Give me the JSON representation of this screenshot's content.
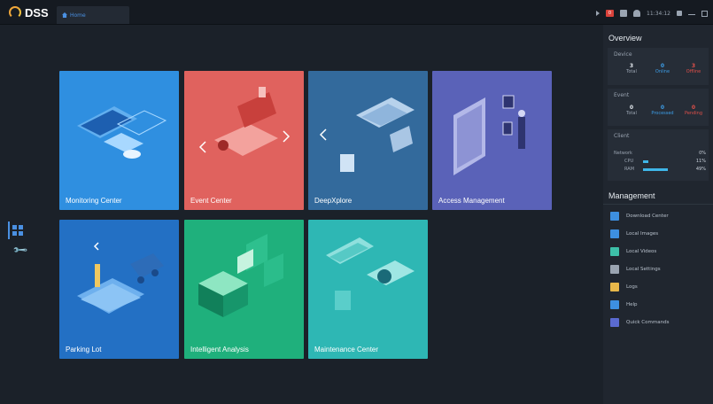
{
  "app": {
    "logo_text": "DSS",
    "home_tab": "Home"
  },
  "tray": {
    "alarm_count": "0",
    "time": "11:34:12"
  },
  "tiles": [
    {
      "label": "Monitoring Center",
      "color": "#2f8fe0"
    },
    {
      "label": "Event Center",
      "color": "#e0625e"
    },
    {
      "label": "DeepXplore",
      "color": "#336a9c"
    },
    {
      "label": "Access Management",
      "color": "#5a62b8"
    },
    {
      "label": "Parking Lot",
      "color": "#2370c4"
    },
    {
      "label": "Intelligent Analysis",
      "color": "#1fb07c"
    },
    {
      "label": "Maintenance Center",
      "color": "#2eb7b4"
    }
  ],
  "overview": {
    "title": "Overview",
    "device": {
      "title": "Device",
      "total": "3",
      "total_label": "Total",
      "online": "0",
      "online_label": "Online",
      "offline": "3",
      "offline_label": "Offline"
    },
    "event": {
      "title": "Event",
      "total": "0",
      "total_label": "Total",
      "processed": "0",
      "processed_label": "Processed",
      "pending": "0",
      "pending_label": "Pending"
    },
    "client": {
      "title": "Client",
      "network_label": "Network",
      "network_value": "0%",
      "network_fill": 0,
      "cpu_label": "CPU",
      "cpu_value": "11%",
      "cpu_fill": 0.11,
      "ram_label": "RAM",
      "ram_value": "49%",
      "ram_fill": 0.49
    }
  },
  "management": {
    "title": "Management",
    "items": [
      {
        "label": "Download Center",
        "icon": "download-icon",
        "color": "#3d8fe0"
      },
      {
        "label": "Local Images",
        "icon": "image-icon",
        "color": "#3d8fe0"
      },
      {
        "label": "Local Videos",
        "icon": "video-icon",
        "color": "#3dbfa8"
      },
      {
        "label": "Local Settings",
        "icon": "settings-icon",
        "color": "#9aa4b1"
      },
      {
        "label": "Logs",
        "icon": "logs-icon",
        "color": "#e8b84a"
      },
      {
        "label": "Help",
        "icon": "help-icon",
        "color": "#3d8fe0"
      },
      {
        "label": "Quick Commands",
        "icon": "commands-icon",
        "color": "#5a6ad0"
      }
    ]
  },
  "colors": {
    "accent": "#4a90e2",
    "online": "#3d9ee8",
    "offline": "#e0504a"
  }
}
